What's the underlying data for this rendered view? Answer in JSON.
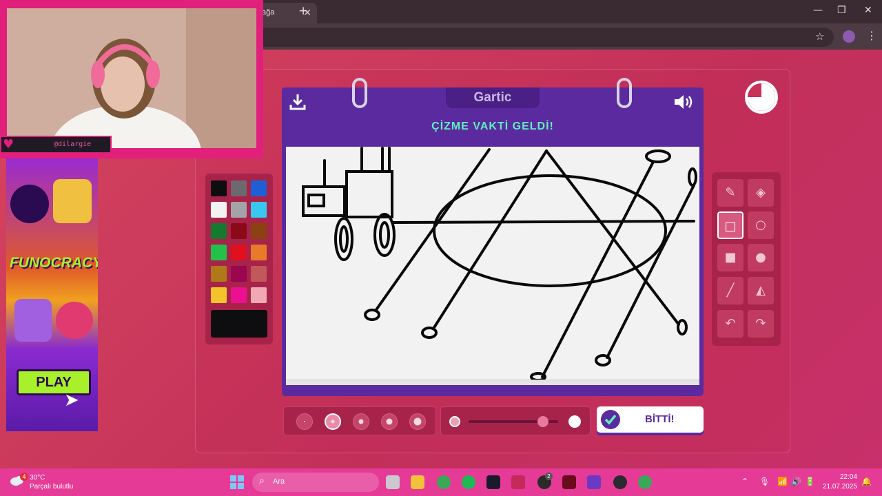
{
  "browser": {
    "tab_title": "ağa",
    "tab_close": "✕",
    "new_tab": "+",
    "window_controls": {
      "minimize": "—",
      "restore": "❐",
      "close": "✕"
    },
    "star": "☆",
    "menu": "⋮"
  },
  "webcam": {
    "handle": "@dilargie"
  },
  "ad": {
    "logo": "FUNOCRACY",
    "play_label": "PLAY"
  },
  "game": {
    "logo": "Gartic",
    "prompt": "ÇİZME VAKTİ GELDİ!",
    "done_label": "BİTTİ!",
    "palette": [
      "#0e0e10",
      "#6b6b6f",
      "#1f5fd6",
      "#f2f2f2",
      "#a3a3a8",
      "#39c6f0",
      "#157a2e",
      "#8a0a18",
      "#8a4212",
      "#22c24a",
      "#e0101e",
      "#e87a2a",
      "#b07818",
      "#9a0650",
      "#c2585a",
      "#f2c32a",
      "#ec1090",
      "#f0a8b2"
    ],
    "current_color": "#0e0e10",
    "brush_sizes_count": 5,
    "active_brush_index": 1,
    "opacity_fraction": 0.83,
    "active_tool": "square-outline",
    "tools": [
      {
        "name": "pencil",
        "icon": "pencil-icon"
      },
      {
        "name": "eraser",
        "icon": "eraser-icon"
      },
      {
        "name": "square-outline",
        "icon": "square-outline-icon"
      },
      {
        "name": "circle-outline",
        "icon": "circle-outline-icon"
      },
      {
        "name": "square-filled",
        "icon": "square-filled-icon"
      },
      {
        "name": "circle-filled",
        "icon": "circle-filled-icon"
      },
      {
        "name": "line",
        "icon": "line-icon"
      },
      {
        "name": "fill",
        "icon": "fill-bucket-icon"
      },
      {
        "name": "undo",
        "icon": "undo-icon"
      },
      {
        "name": "redo",
        "icon": "redo-icon"
      }
    ]
  },
  "taskbar": {
    "weather_badge": "4",
    "temperature": "30°C",
    "weather": "Parçalı bulutlu",
    "search_placeholder": "Ara",
    "xbox_badge": "2",
    "time": "22:04",
    "date": "21.07.2025"
  }
}
